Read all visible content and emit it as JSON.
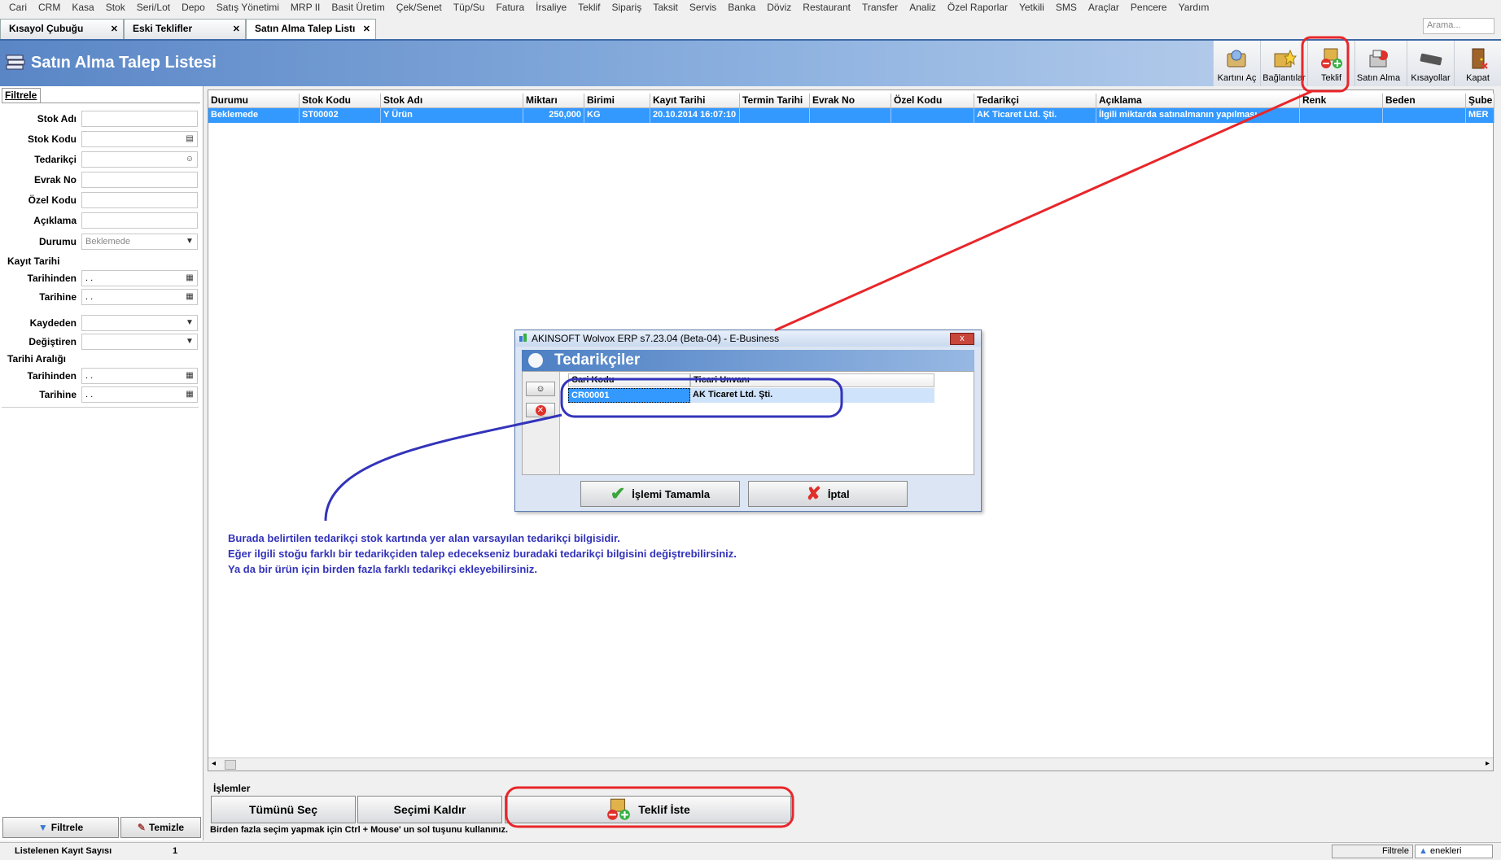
{
  "menu": [
    "Cari",
    "CRM",
    "Kasa",
    "Stok",
    "Seri/Lot",
    "Depo",
    "Satış Yönetimi",
    "MRP II",
    "Basit Üretim",
    "Çek/Senet",
    "Tüp/Su",
    "Fatura",
    "İrsaliye",
    "Teklif",
    "Sipariş",
    "Taksit",
    "Servis",
    "Banka",
    "Döviz",
    "Restaurant",
    "Transfer",
    "Analiz",
    "Özel Raporlar",
    "Yetkili",
    "SMS",
    "Araçlar",
    "Pencere",
    "Yardım"
  ],
  "search_placeholder": "Arama...",
  "tabs": [
    {
      "label": "Kısayol Çubuğu"
    },
    {
      "label": "Eski Teklifler"
    },
    {
      "label": "Satın Alma Talep Listı"
    }
  ],
  "page_title": "Satın Alma Talep Listesi",
  "toolbar": {
    "kartini_ac": "Kartını Aç",
    "baglantilar": "Bağlantılar",
    "teklif": "Teklif",
    "satin_alma": "Satın Alma",
    "kisayollar": "Kısayollar",
    "kapat": "Kapat"
  },
  "filter": {
    "tab_label": "Filtrele",
    "stok_adi": "Stok Adı",
    "stok_kodu": "Stok Kodu",
    "tedarikci": "Tedarikçi",
    "evrak_no": "Evrak No",
    "ozel_kodu": "Özel Kodu",
    "aciklama": "Açıklama",
    "durumu": "Durumu",
    "durumu_value": "Beklemede",
    "kayit_tarihi": "Kayıt Tarihi",
    "tarihinden": "Tarihinden",
    "tarihine": "Tarihine",
    "date_empty": ". .",
    "kaydeden": "Kaydeden",
    "degistiren": "Değiştiren",
    "tarih_araligi": "Tarihi Aralığı",
    "filtrele_btn": "Filtrele",
    "temizle_btn": "Temizle"
  },
  "grid": {
    "columns": [
      "Durumu",
      "Stok Kodu",
      "Stok Adı",
      "Miktarı",
      "Birimi",
      "Kayıt Tarihi",
      "Termin Tarihi",
      "Evrak No",
      "Özel Kodu",
      "Tedarikçi",
      "Açıklama",
      "Renk",
      "Beden",
      "Şube"
    ],
    "rows": [
      [
        "Beklemede",
        "ST00002",
        "Y Ürün",
        "250,000",
        "KG",
        "20.10.2014 16:07:10",
        "",
        "",
        "",
        "AK Ticaret Ltd. Şti.",
        "İlgili miktarda satınalmanın yapılması",
        "",
        "",
        "MER"
      ]
    ]
  },
  "islemler": {
    "label": "İşlemler",
    "tumunu_sec": "Tümünü Seç",
    "secimi_kaldir": "Seçimi Kaldır",
    "teklif_iste": "Teklif İste",
    "hint": "Birden fazla seçim yapmak için Ctrl + Mouse' un sol tuşunu kullanınız."
  },
  "status": {
    "label": "Listelenen Kayıt Sayısı",
    "count": "1",
    "filtrele": "Filtrele",
    "secenekler": "enekleri"
  },
  "dialog": {
    "title": "AKINSOFT Wolvox ERP s7.23.04 (Beta-04) - E-Business",
    "close": "x",
    "header": "Tedarikçiler",
    "col_cari_kodu": "Cari Kodu",
    "col_ticari_unvani": "Ticari Unvanı",
    "cari_kodu": "CR00001",
    "ticari_unvani": "AK Ticaret Ltd. Şti.",
    "ok": "İşlemi Tamamla",
    "cancel": "İptal"
  },
  "annotation": {
    "line1": "Burada belirtilen tedarikçi stok kartında yer alan varsayılan tedarikçi bilgisidir.",
    "line2": "Eğer ilgili stoğu farklı bir tedarikçiden talep edecekseniz buradaki tedarikçi bilgisini değiştrebilirsiniz.",
    "line3": "Ya da bir ürün için birden fazla farklı tedarikçi ekleyebilirsiniz."
  },
  "colors": {
    "selection": "#3399ff",
    "annotation_red": "#e8262a",
    "annotation_blue": "#3333bb",
    "title_blue": "#5a86c6"
  }
}
